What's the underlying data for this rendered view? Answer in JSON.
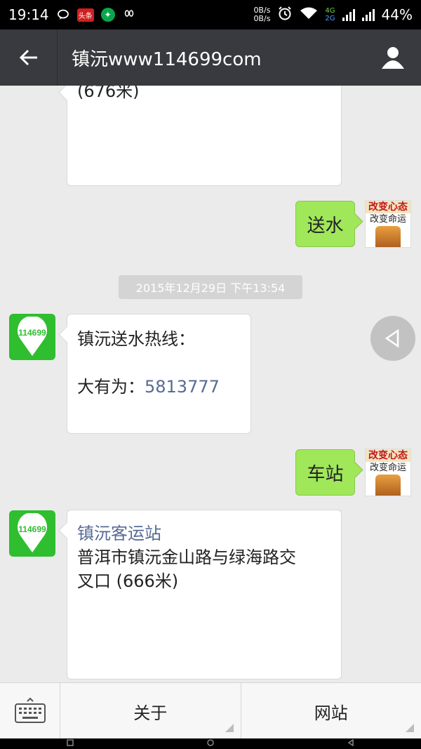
{
  "status_bar": {
    "time": "19:14",
    "notif_news_label": "头条",
    "net_up": "0B/s",
    "net_down": "0B/s",
    "net_type_1": "4G",
    "net_type_2": "2G",
    "battery": "44%"
  },
  "header": {
    "title": "镇沅www114699com"
  },
  "messages": {
    "partial_text": "(676米)",
    "out1": "送水",
    "timestamp": "2015年12月29日 下午13:54",
    "in1_line1": "镇沅送水热线：",
    "in1_line2_label": "大有为：",
    "in1_line2_phone": "5813777",
    "out2": "车站",
    "in2_title": "镇沅客运站",
    "in2_line1": "普洱市镇沅金山路与绿海路交",
    "in2_line2": "叉口 (666米)"
  },
  "avatars": {
    "app_label": "114699",
    "user_line1": "改变心态",
    "user_line2": "改变命运"
  },
  "bottom_menu": {
    "about": "关于",
    "website": "网站"
  },
  "icons": {
    "back": "back-arrow-icon",
    "profile": "person-icon",
    "keyboard": "keyboard-icon",
    "float": "triangle-left-icon"
  },
  "colors": {
    "header_bg": "#393a3f",
    "bubble_out": "#a0e75a",
    "link": "#576b95",
    "app_green": "#2fbe2f"
  }
}
